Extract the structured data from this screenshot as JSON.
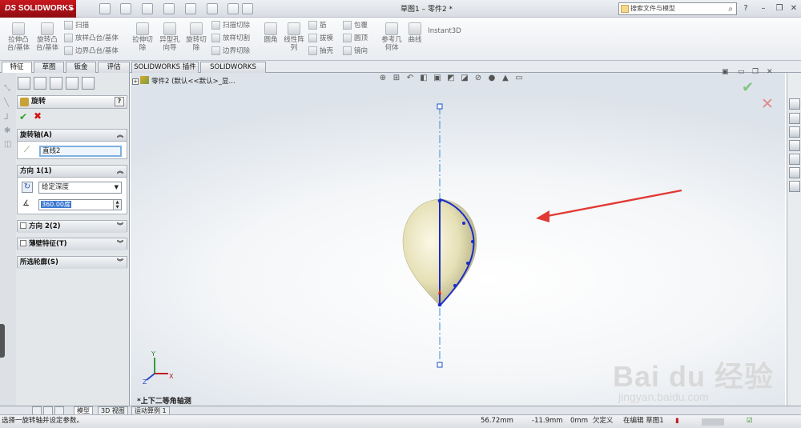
{
  "app": {
    "logo_text": "SOLIDWORKS",
    "logo_prefix": "DS",
    "doc_title": "草图1 – 零件2 *"
  },
  "search": {
    "value": "搜索文件与模型"
  },
  "ribbon": {
    "extrude_boss": "拉伸凸\n台/基体",
    "revolve_boss": "旋转凸\n台/基体",
    "sweep": "扫描",
    "loft_boss": "放样凸台/基体",
    "boundary_boss": "边界凸台/基体",
    "extrude_cut": "拉伸切\n除",
    "hole_wizard": "异型孔\n向导",
    "revolve_cut": "旋转切\n除",
    "swept_cut": "扫描切除",
    "lofted_cut": "放样切割",
    "boundary_cut": "边界切除",
    "fillet": "圆角",
    "linear_pattern": "线性阵\n列",
    "rib": "筋",
    "draft": "拔模",
    "shell": "抽壳",
    "wrap": "包覆",
    "dome": "圆顶",
    "mirror": "镜向",
    "ref_geometry": "参考几\n何体",
    "curves": "曲线",
    "instant3d": "Instant3D"
  },
  "tabs": [
    "特征",
    "草图",
    "钣金",
    "评估",
    "SOLIDWORKS 插件",
    "SOLIDWORKS MBD"
  ],
  "property_manager": {
    "title": "旋转",
    "help": "?",
    "axis_group": {
      "title": "旋转轴(A)",
      "value": "直线2"
    },
    "direction1": {
      "title": "方向 1(1)",
      "type": "给定深度",
      "angle": "360.00度"
    },
    "direction2": {
      "title": "方向 2(2)"
    },
    "thin": {
      "title": "薄壁特征(T)"
    },
    "contours": {
      "title": "所选轮廓(S)"
    }
  },
  "tree": {
    "root": "零件2 (默认<<默认>_显..."
  },
  "viewport": {
    "view_label": "*上下二等角轴测",
    "axis_x": "X",
    "axis_y": "Y",
    "axis_z": "Z"
  },
  "bottom_tabs": [
    "模型",
    "3D 视图",
    "运动算例 1"
  ],
  "status": {
    "message": "选择一旋转轴并设定参数。",
    "coord_x": "56.72mm",
    "coord_y": "-11.9mm",
    "coord_z": "0mm",
    "state": "欠定义",
    "mode": "在编辑 草图1"
  },
  "watermark": {
    "text": "Bai du 经验",
    "url": "jingyan.baidu.com"
  },
  "colors": {
    "brand": "#c8181e",
    "sketch": "#1a2dc8",
    "body": "#e8e3bc",
    "arrow": "#e23a35",
    "ok": "#2fa02f",
    "cancel": "#d01515"
  }
}
